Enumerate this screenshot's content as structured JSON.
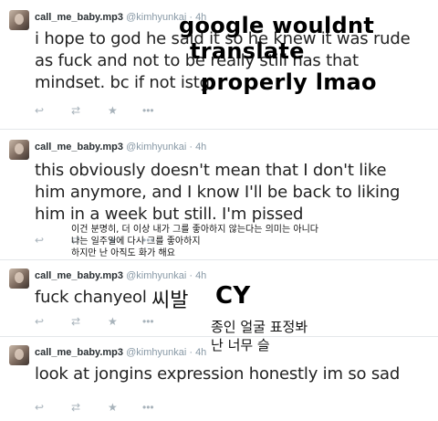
{
  "tweets": [
    {
      "username": "call_me_baby.mp3",
      "handle": "@kimhyunkai",
      "time": "· 4h",
      "text_lines": [
        "i hope to god he said it so he knew it was rude",
        "as fuck and not to be really still has that",
        "mindset. bc if not      istg"
      ]
    },
    {
      "username": "call_me_baby.mp3",
      "handle": "@kimhyunkai",
      "time": "· 4h",
      "text_lines": [
        "this obviously doesn't mean that I don't like",
        "him anymore, and I know I'll be back to liking",
        "him in a week but still. I'm pissed"
      ]
    },
    {
      "username": "call_me_baby.mp3",
      "handle": "@kimhyunkai",
      "time": "· 4h",
      "text_lines": [
        "fuck chanyeol"
      ]
    },
    {
      "username": "call_me_baby.mp3",
      "handle": "@kimhyunkai",
      "time": "· 4h",
      "text_lines": [
        "look at jongins expression honestly im so sad"
      ]
    }
  ],
  "action_icons": [
    "reply-icon",
    "retweet-icon",
    "favorite-icon",
    "more-icon"
  ],
  "action_glyphs": {
    "reply": "↩",
    "retweet": "⇄",
    "favorite": "★",
    "more": "•••"
  },
  "overlays": {
    "google_caption": [
      "google wouldnt",
      "translate",
      "properly lmao"
    ],
    "korean_translation": [
      "이건 분명히, 더 이상 내가 그를 좋아하지 않는다는 의미는 아니다",
      "나는 일주일에 다시 그를 좋아하지",
      "하지만 난 아직도 화가 해요"
    ],
    "korean_swear": "씨발",
    "cy_label": "CY",
    "korean_expression": [
      "종인 얼굴 표정봐",
      "난 너무 슬"
    ]
  },
  "colors": {
    "separator": "#e4e7ea",
    "meta_gray": "#8899a6",
    "action_gray": "#a8b3bb"
  }
}
